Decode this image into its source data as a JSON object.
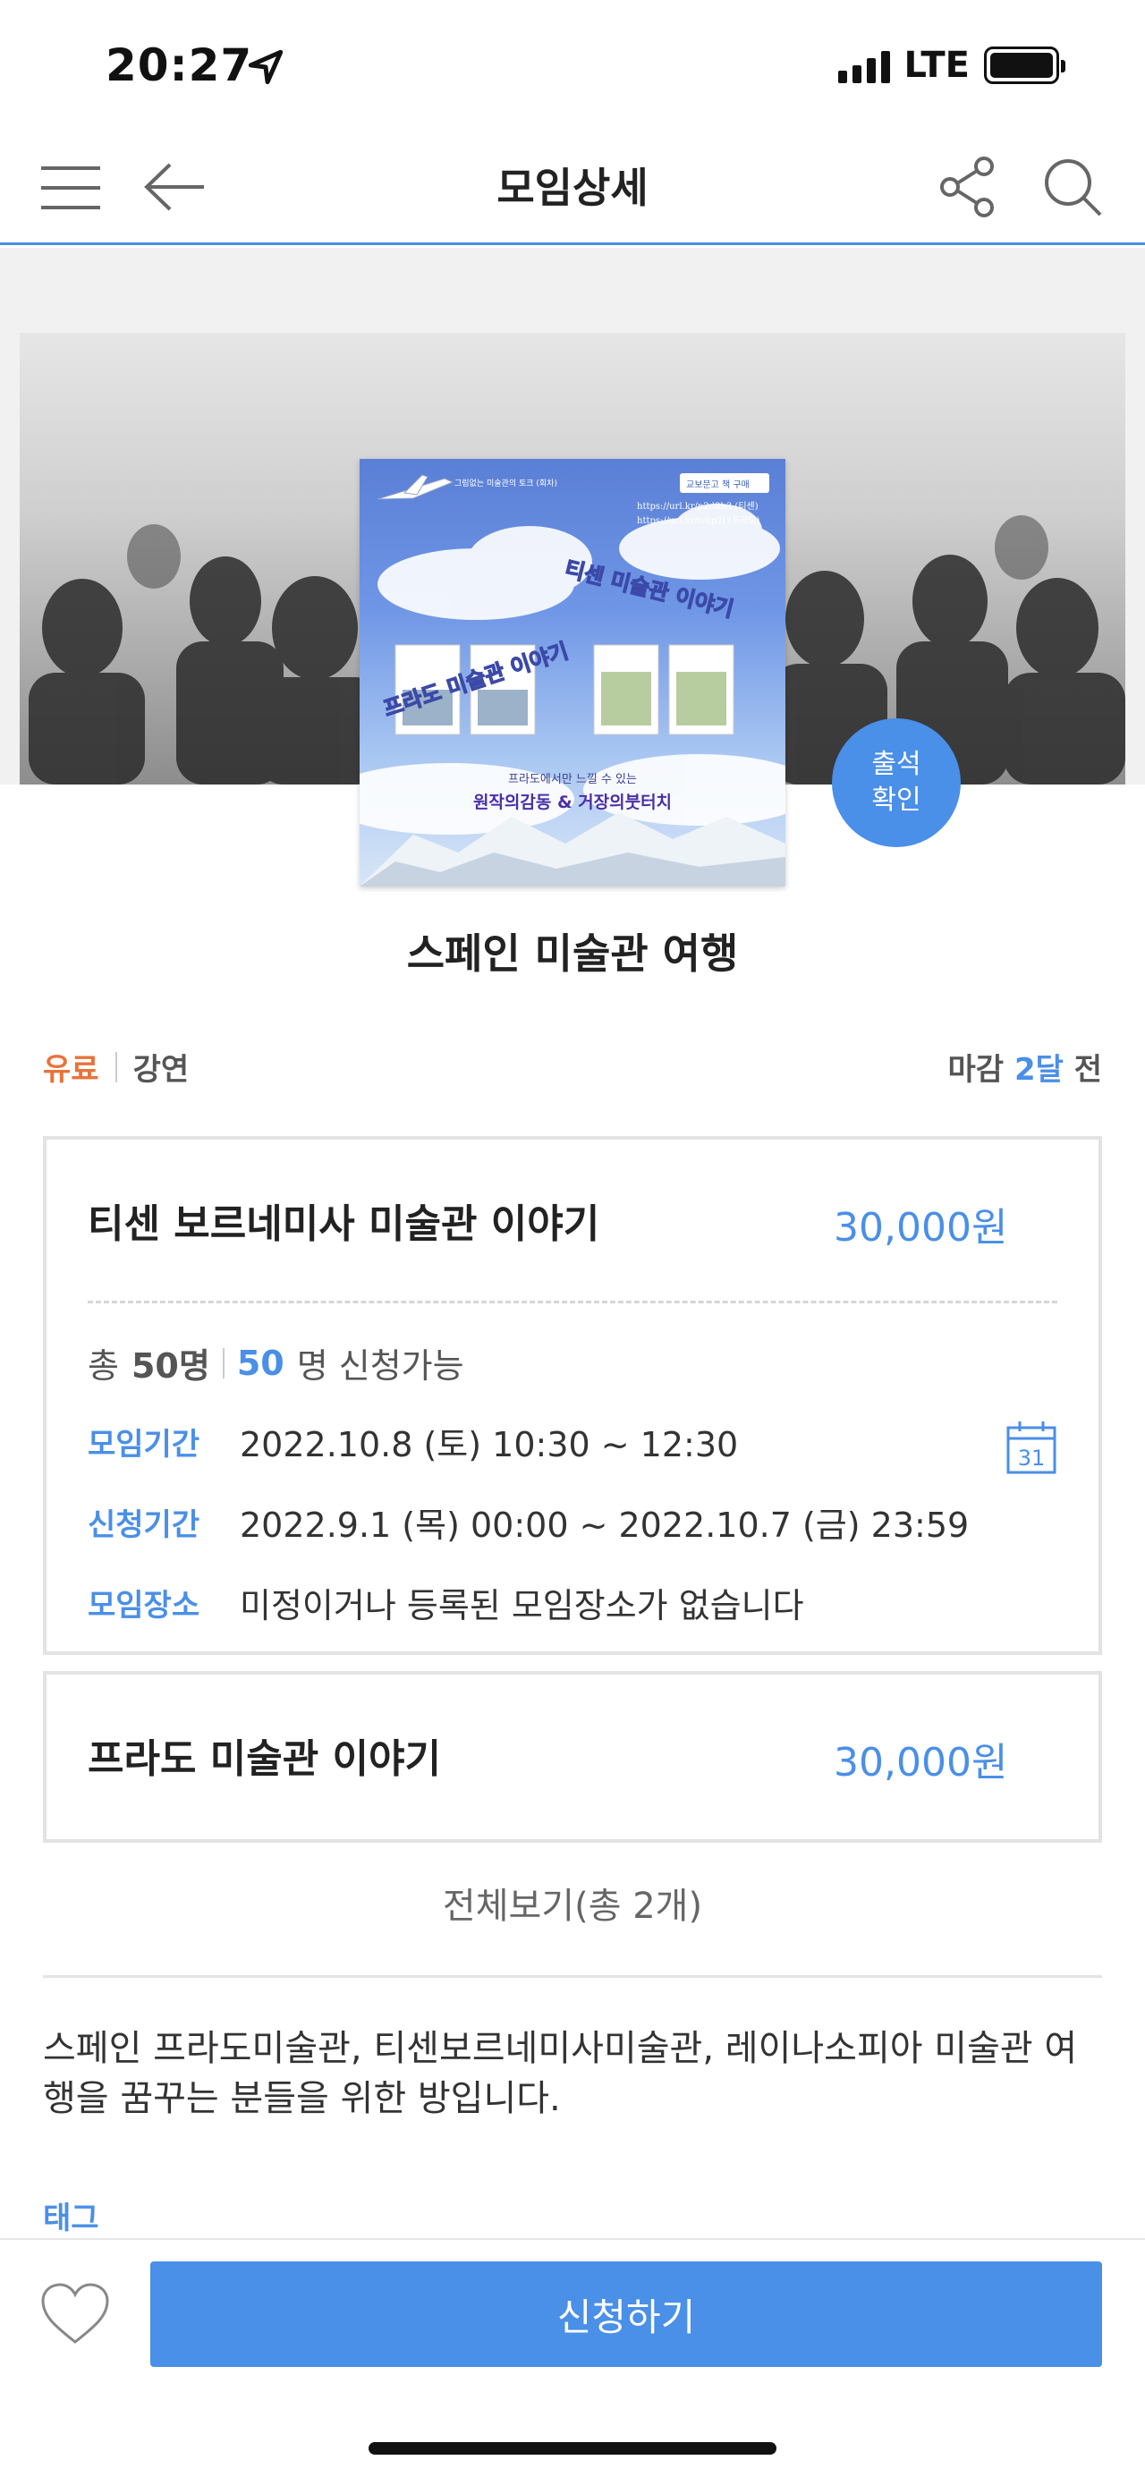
{
  "status_bar": {
    "time": "20:27",
    "network": "LTE"
  },
  "header": {
    "title": "모임상세"
  },
  "poster": {
    "line_top": "그림없는 미술관의 토크 (회차)",
    "badge": "교보문고 책 구매",
    "url1": "https://url.kr/p2d8h3 (티센)",
    "url2": "https://url.kr/ivkp2l (프라도)",
    "title_a": "티센 미술관 이야기",
    "title_b": "프라도 미술관 이야기",
    "sub1": "프라도에서만 느낄 수 있는",
    "sub2": "원작의감동 & 거장의붓터치"
  },
  "attend": {
    "line1": "출석",
    "line2": "확인"
  },
  "event": {
    "title": "스페인 미술관 여행",
    "paid": "유료",
    "type": "강연",
    "deadline_prefix": "마감",
    "deadline_value": "2달",
    "deadline_suffix": "전"
  },
  "card1": {
    "name": "티센 보르네미사 미술관 이야기",
    "price": "30,000원",
    "total_prefix": "총",
    "total_value": "50명",
    "available_value": "50",
    "available_suffix": "명 신청가능",
    "period_label": "모임기간",
    "period_value": "2022.10.8 (토) 10:30 ~ 12:30",
    "apply_label": "신청기간",
    "apply_value": "2022.9.1 (목) 00:00 ~ 2022.10.7 (금) 23:59",
    "place_label": "모임장소",
    "place_value": "미정이거나 등록된 모임장소가 없습니다",
    "calendar_day": "31"
  },
  "card2": {
    "name": "프라도 미술관 이야기",
    "price": "30,000원"
  },
  "view_all": "전체보기(총 2개)",
  "description": "스페인 프라도미술관, 티센보르네미사미술관, 레이나소피아 미술관 여행을 꿈꾸는 분들을 위한 방입니다.",
  "tag_label": "태그",
  "apply_button": "신청하기",
  "colors": {
    "accent": "#4a8fe8",
    "paid": "#e8733a"
  }
}
